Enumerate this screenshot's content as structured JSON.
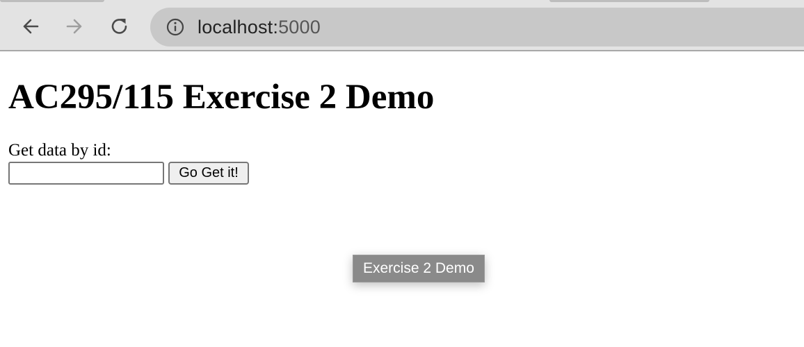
{
  "browser": {
    "url_host": "localhost:",
    "url_port": "5000",
    "icons": {
      "back": "arrow-left-icon",
      "forward": "arrow-right-icon",
      "reload": "reload-icon",
      "site_info": "info-icon"
    },
    "colors": {
      "toolbar_bg": "#e3e3e3",
      "omnibox_bg": "#c8c8c8",
      "icon_active": "#4a4a4a",
      "icon_disabled": "#9e9e9e"
    }
  },
  "page": {
    "title": "AC295/115 Exercise 2 Demo",
    "form": {
      "label": "Get data by id:",
      "input_value": "",
      "button_label": "Go Get it!"
    },
    "tooltip": "Exercise 2 Demo"
  }
}
